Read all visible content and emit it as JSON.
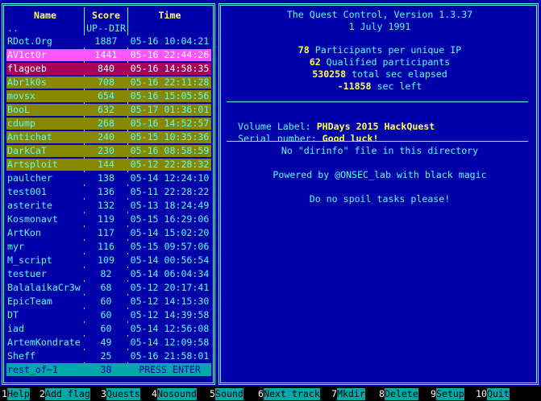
{
  "left_panel": {
    "headers": {
      "name": "Name",
      "score": "Score",
      "time": "Time"
    },
    "updir": {
      "name": "..",
      "score": "UP--DIR"
    },
    "rows": [
      {
        "name": "RDot.Org",
        "score": "1887",
        "time": "05-16 10:04:21",
        "bg": "#0000a8",
        "fg": "#55ffff"
      },
      {
        "name": "AV1ct0r",
        "score": "1441",
        "time": "05-16 22:44:26",
        "bg": "#ff55ff",
        "fg": "#ffffff"
      },
      {
        "name": "flagoeb",
        "score": "840",
        "time": "05-16 14:58:35",
        "bg": "#a8005a",
        "fg": "#ffffff"
      },
      {
        "name": "Abr1k0s",
        "score": "708",
        "time": "05-16 22:11:28",
        "bg": "#888800",
        "fg": "#55ffff"
      },
      {
        "name": "movsx",
        "score": "654",
        "time": "05-16 15:05:56",
        "bg": "#888800",
        "fg": "#55ffff"
      },
      {
        "name": "BooL",
        "score": "632",
        "time": "05-17 01:36:01",
        "bg": "#888800",
        "fg": "#55ffff"
      },
      {
        "name": "cdump",
        "score": "268",
        "time": "05-16 14:52:57",
        "bg": "#888800",
        "fg": "#55ffff"
      },
      {
        "name": "Antichat",
        "score": "240",
        "time": "05-15 10:35:36",
        "bg": "#888800",
        "fg": "#55ffff"
      },
      {
        "name": "DarkCaT",
        "score": "230",
        "time": "05-16 08:58:59",
        "bg": "#888800",
        "fg": "#55ffff"
      },
      {
        "name": "Artsploit",
        "score": "144",
        "time": "05-12 22:28:32",
        "bg": "#888800",
        "fg": "#55ffff"
      },
      {
        "name": "paulcher",
        "score": "138",
        "time": "05-14 12:24:10",
        "bg": "#0000a8",
        "fg": "#55ffff"
      },
      {
        "name": "test001",
        "score": "136",
        "time": "05-11 22:28:22",
        "bg": "#0000a8",
        "fg": "#55ffff"
      },
      {
        "name": "asterite",
        "score": "132",
        "time": "05-13 18:24:49",
        "bg": "#0000a8",
        "fg": "#55ffff"
      },
      {
        "name": "Kosmonavt",
        "score": "119",
        "time": "05-15 16:29:06",
        "bg": "#0000a8",
        "fg": "#55ffff"
      },
      {
        "name": "ArtKon",
        "score": "117",
        "time": "05-14 15:02:20",
        "bg": "#0000a8",
        "fg": "#55ffff"
      },
      {
        "name": "myr",
        "score": "116",
        "time": "05-15 09:57:06",
        "bg": "#0000a8",
        "fg": "#55ffff"
      },
      {
        "name": "M_script",
        "score": "109",
        "time": "05-14 00:56:54",
        "bg": "#0000a8",
        "fg": "#55ffff"
      },
      {
        "name": "testuer",
        "score": "82",
        "time": "05-14 06:04:34",
        "bg": "#0000a8",
        "fg": "#55ffff"
      },
      {
        "name": "BalalaikaCr3w",
        "score": "68",
        "time": "05-12 20:17:41",
        "bg": "#0000a8",
        "fg": "#55ffff"
      },
      {
        "name": "EpicTeam",
        "score": "60",
        "time": "05-12 14:15:30",
        "bg": "#0000a8",
        "fg": "#55ffff"
      },
      {
        "name": "DT",
        "score": "60",
        "time": "05-12 14:39:58",
        "bg": "#0000a8",
        "fg": "#55ffff"
      },
      {
        "name": "iad",
        "score": "60",
        "time": "05-14 12:56:08",
        "bg": "#0000a8",
        "fg": "#55ffff"
      },
      {
        "name": "ArtemKondrate",
        "score": "49",
        "time": "05-14 12:09:58",
        "bg": "#0000a8",
        "fg": "#55ffff"
      },
      {
        "name": "Sheff",
        "score": "25",
        "time": "05-16 21:58:01",
        "bg": "#0000a8",
        "fg": "#55ffff"
      }
    ],
    "footer": {
      "name": "rest_of~1",
      "score": "38",
      "time": "PRESS ENTER"
    }
  },
  "right_panel": {
    "title": "The Quest Control, Version 1.3.37",
    "date": "1 July 1991",
    "stats": [
      {
        "value": "78",
        "label": " Participants per unique IP"
      },
      {
        "value": "62",
        "label": " Qualified participants"
      },
      {
        "value": "530258",
        "label": " total sec elapsed"
      },
      {
        "value": "-11858",
        "label": " sec left"
      }
    ],
    "volume_label": {
      "key": "Volume Label: ",
      "value": "PHDays 2015 HackQuest"
    },
    "serial_number": {
      "key": "Serial number: ",
      "value": "Good luck!"
    },
    "no_dirinfo": "No \"dirinfo\" file in this directory",
    "powered_by": "Powered by @ONSEC_lab with black magic",
    "no_spoil": "Do no spoil tasks please!"
  },
  "function_keys": [
    {
      "num": "1",
      "label": "Help"
    },
    {
      "num": "2",
      "label": "Add flag"
    },
    {
      "num": "3",
      "label": "Quests"
    },
    {
      "num": "4",
      "label": "Nosound"
    },
    {
      "num": "5",
      "label": "Sound"
    },
    {
      "num": "6",
      "label": "Next track"
    },
    {
      "num": "7",
      "label": "Mkdir"
    },
    {
      "num": "8",
      "label": "Delete"
    },
    {
      "num": "9",
      "label": "Setup"
    },
    {
      "num": "10",
      "label": "Quit"
    }
  ],
  "colors": {
    "panel_bg": "#0000a8",
    "border": "#55ffff",
    "header": "#ffff55",
    "fkey_bar": "#000000",
    "fkey_label_bg": "#00a8a8"
  }
}
